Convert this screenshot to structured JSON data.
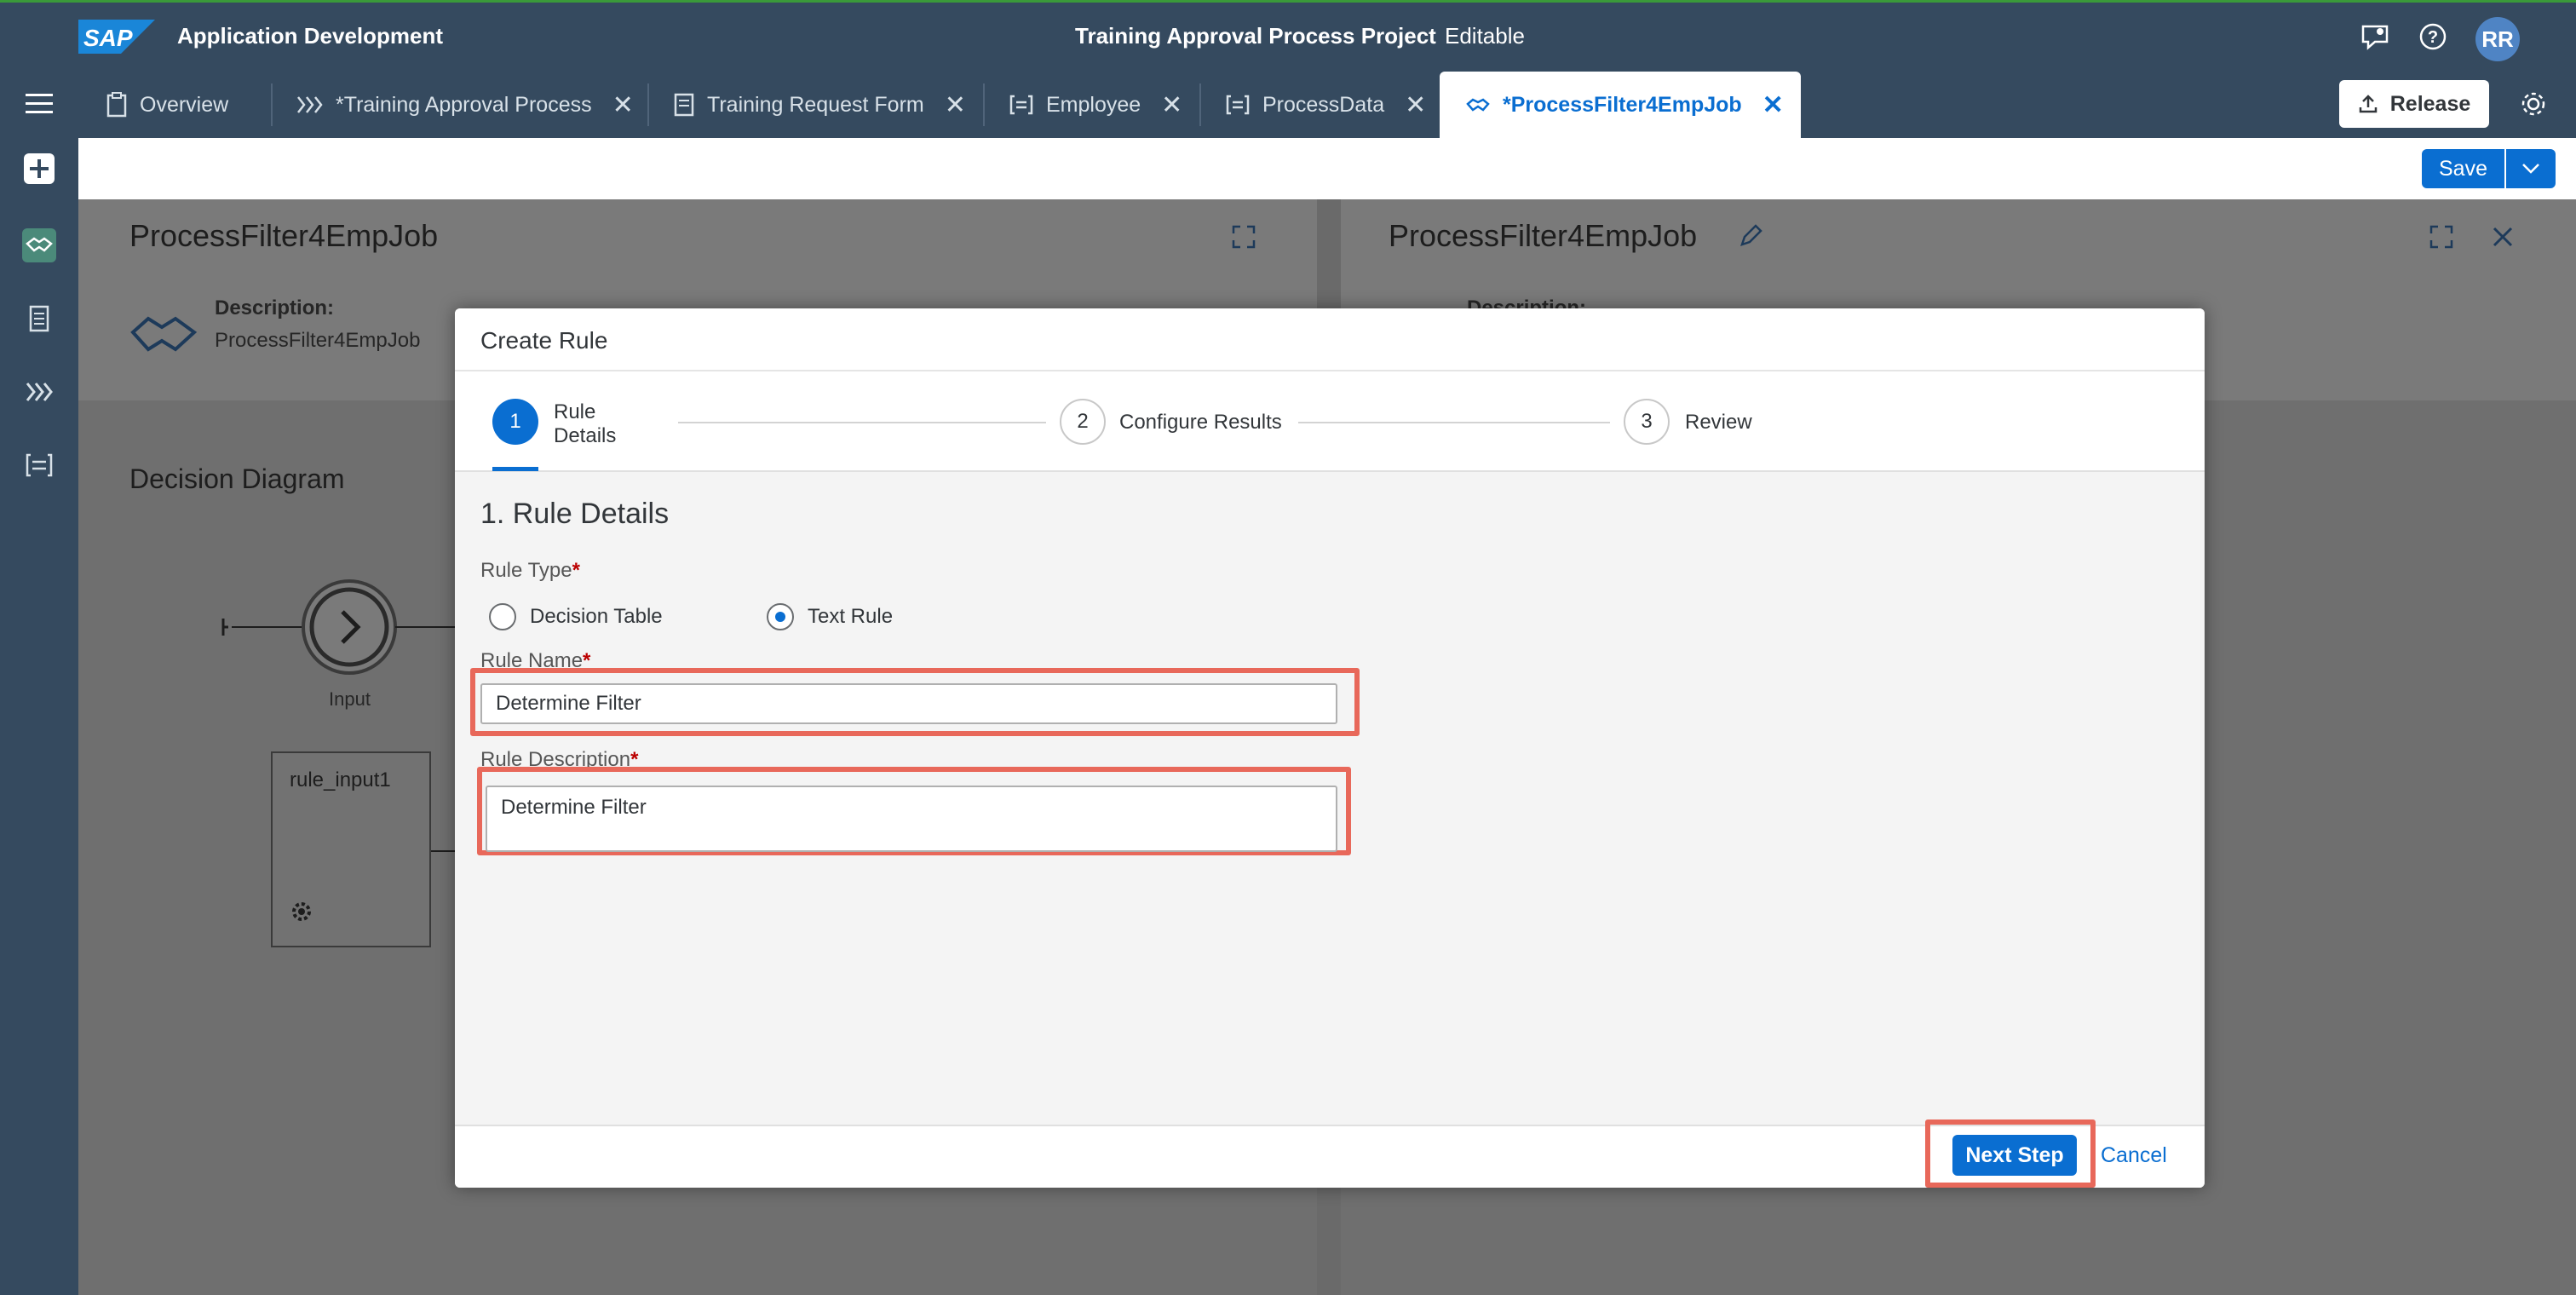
{
  "shell": {
    "logo_text": "SAP",
    "app_title": "Application Development",
    "project_title": "Training Approval Process Project",
    "mode": "Editable",
    "avatar_initials": "RR"
  },
  "tabs": [
    {
      "label": "Overview"
    },
    {
      "label": "*Training Approval Process"
    },
    {
      "label": "Training Request Form"
    },
    {
      "label": "Employee"
    },
    {
      "label": "ProcessData"
    },
    {
      "label": "*ProcessFilter4EmpJob"
    }
  ],
  "header_actions": {
    "release_label": "Release"
  },
  "toolbar": {
    "save_label": "Save"
  },
  "background": {
    "left_title": "ProcessFilter4EmpJob",
    "right_title": "ProcessFilter4EmpJob",
    "description_label": "Description:",
    "description_value": "ProcessFilter4EmpJob",
    "right_description_label": "Description:",
    "diagram_title": "Decision Diagram",
    "input_label": "Input",
    "rule_box_label": "rule_input1"
  },
  "dialog": {
    "title": "Create Rule",
    "steps": [
      {
        "number": "1",
        "label": "Rule Details"
      },
      {
        "number": "2",
        "label": "Configure Results"
      },
      {
        "number": "3",
        "label": "Review"
      }
    ],
    "section_title": "1. Rule Details",
    "rule_type_label": "Rule Type",
    "rule_type_options": [
      "Decision Table",
      "Text Rule"
    ],
    "rule_type_selected": "Text Rule",
    "rule_name_label": "Rule Name",
    "rule_name_value": "Determine Filter",
    "rule_description_label": "Rule Description",
    "rule_description_value": "Determine Filter",
    "required_marker": "*",
    "next_label": "Next Step",
    "cancel_label": "Cancel"
  },
  "colors": {
    "shell": "#354a5f",
    "accent": "#0a6ed1",
    "highlight": "#e8685a",
    "required": "#bb0000"
  }
}
